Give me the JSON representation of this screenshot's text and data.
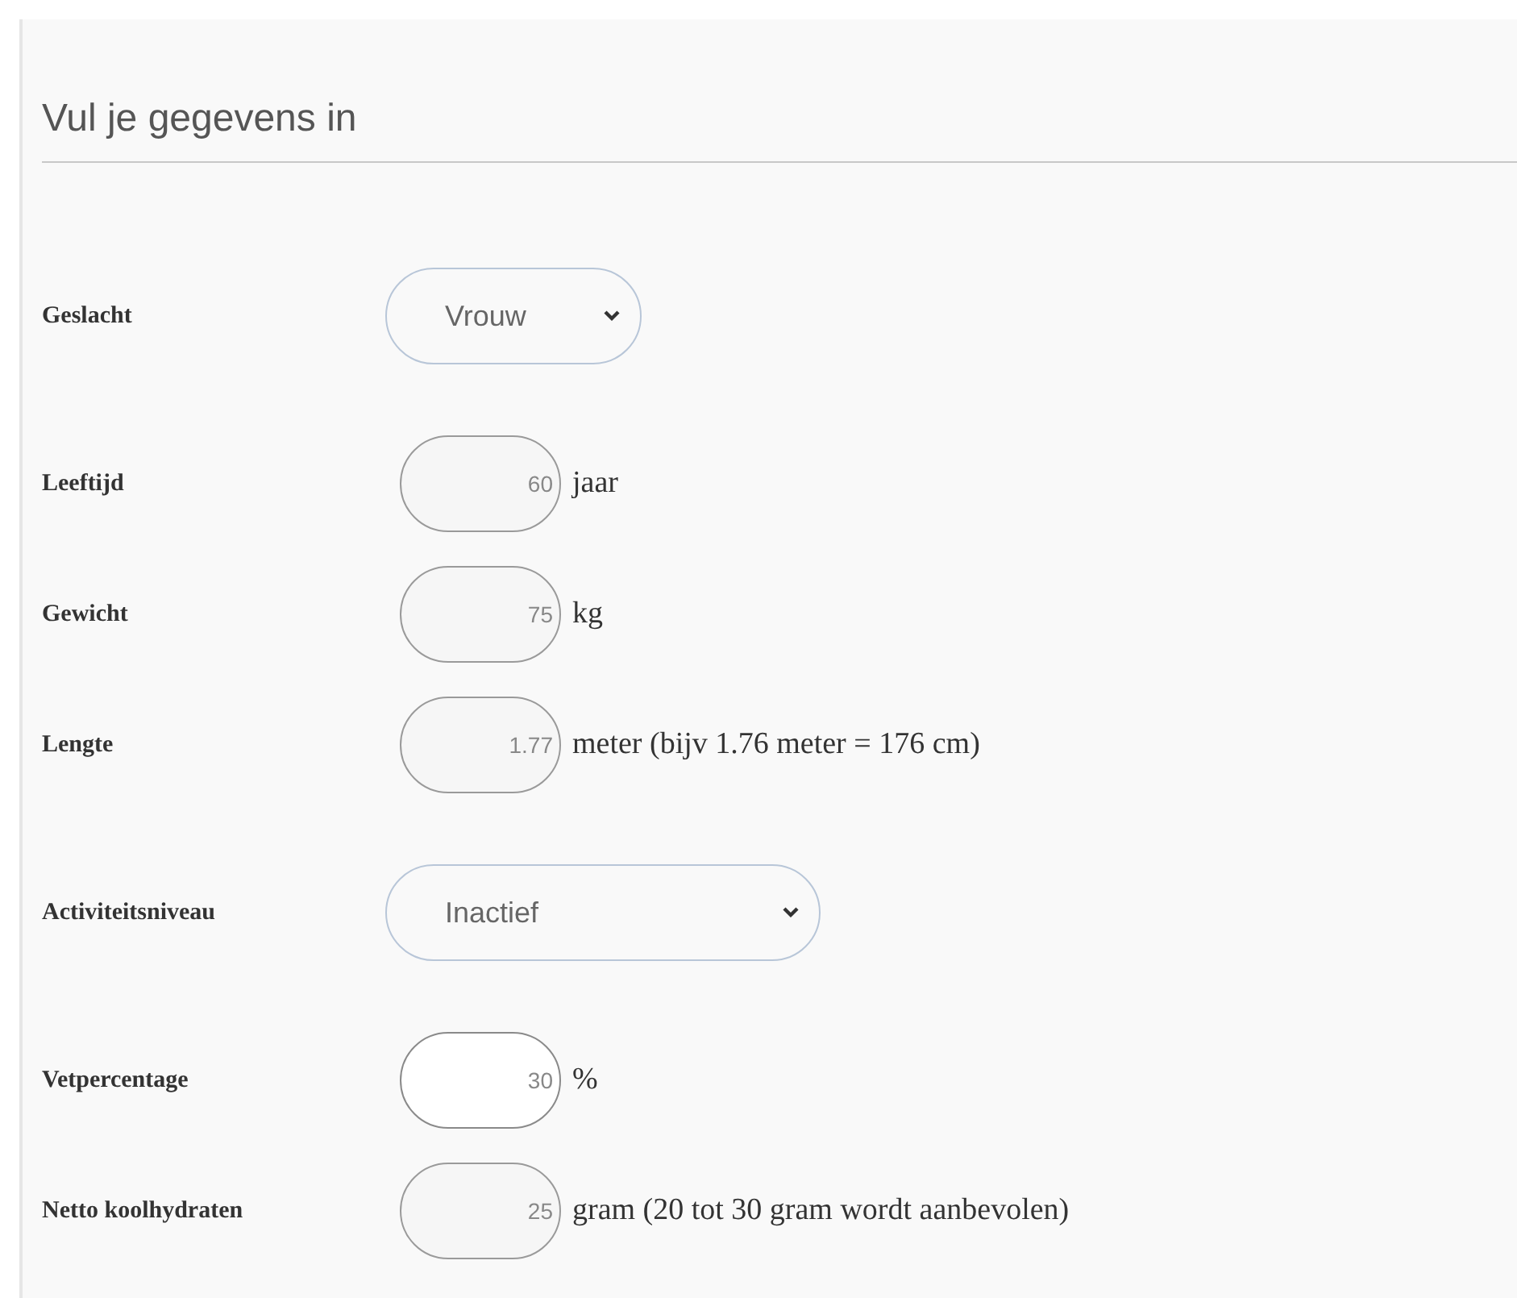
{
  "title": "Vul je gegevens in",
  "fields": [
    {
      "kind": "select",
      "label": "Geslacht",
      "value": "Vrouw"
    },
    {
      "kind": "number",
      "label": "Leeftijd",
      "value": "60",
      "unit": "jaar",
      "focused": false
    },
    {
      "kind": "number",
      "label": "Gewicht",
      "value": "75",
      "unit": "kg",
      "focused": false
    },
    {
      "kind": "number",
      "label": "Lengte",
      "value": "1.77",
      "unit": "meter (bijv 1.76 meter = 176 cm)",
      "focused": false
    },
    {
      "kind": "select",
      "label": "Activiteitsniveau",
      "value": "Inactief"
    },
    {
      "kind": "number",
      "label": "Vetpercentage",
      "value": "30",
      "unit": "%",
      "focused": true
    },
    {
      "kind": "number",
      "label": "Netto koolhydraten",
      "value": "25",
      "unit": "gram (20 tot 30 gram wordt aanbevolen)",
      "focused": false
    }
  ]
}
